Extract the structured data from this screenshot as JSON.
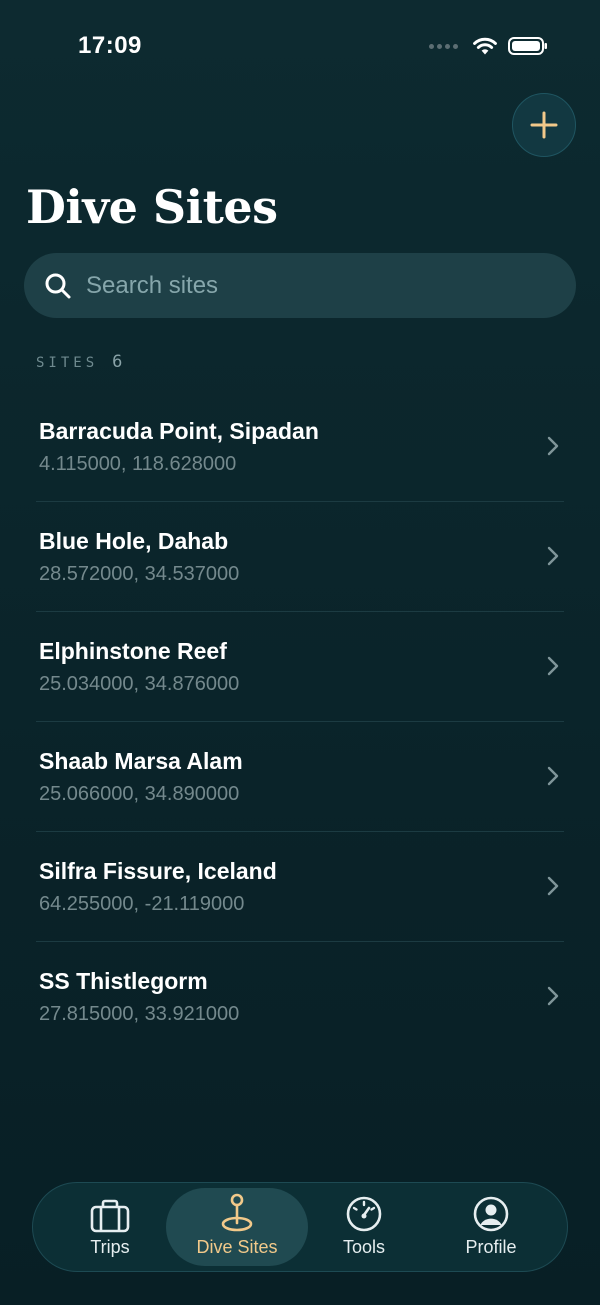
{
  "status_bar": {
    "time": "17:09"
  },
  "header": {
    "title": "Dive Sites",
    "add_icon": "plus-icon"
  },
  "search": {
    "placeholder": "Search sites",
    "icon": "search-icon"
  },
  "section": {
    "label": "SITES",
    "count": "6"
  },
  "sites": [
    {
      "name": "Barracuda Point, Sipadan",
      "coords": "4.115000, 118.628000"
    },
    {
      "name": "Blue Hole, Dahab",
      "coords": "28.572000, 34.537000"
    },
    {
      "name": "Elphinstone Reef",
      "coords": "25.034000, 34.876000"
    },
    {
      "name": "Shaab Marsa Alam",
      "coords": "25.066000, 34.890000"
    },
    {
      "name": "Silfra Fissure, Iceland",
      "coords": "64.255000, -21.119000"
    },
    {
      "name": "SS Thistlegorm",
      "coords": "27.815000, 33.921000"
    }
  ],
  "tab_bar": {
    "active": "Dive Sites",
    "tabs": [
      {
        "label": "Trips",
        "icon": "briefcase-icon"
      },
      {
        "label": "Dive Sites",
        "icon": "map-pin-icon"
      },
      {
        "label": "Tools",
        "icon": "gauge-icon"
      },
      {
        "label": "Profile",
        "icon": "profile-icon"
      }
    ]
  },
  "colors": {
    "background": "#0a2329",
    "accent": "#f2c98a",
    "search_bg": "#1e4047",
    "muted_text": "#74898d"
  }
}
